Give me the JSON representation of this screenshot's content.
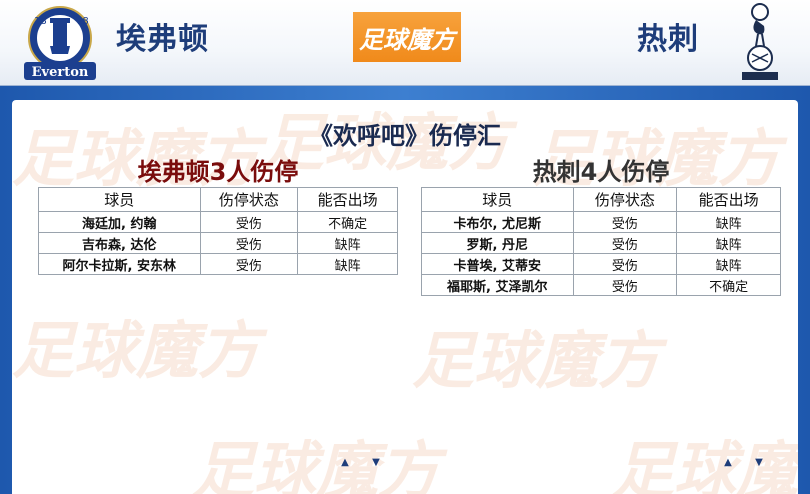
{
  "header": {
    "home_team": "埃弗顿",
    "away_team": "热刺",
    "brand": "足球魔方",
    "home_crest_text": "Everton",
    "home_crest_years": [
      "18",
      "78"
    ]
  },
  "title": "《欢呼吧》伤停汇",
  "home": {
    "section_title": "埃弗顿3人伤停",
    "columns": [
      "球员",
      "伤停状态",
      "能否出场"
    ],
    "rows": [
      [
        "海廷加, 约翰",
        "受伤",
        "不确定"
      ],
      [
        "吉布森, 达伦",
        "受伤",
        "缺阵"
      ],
      [
        "阿尔卡拉斯, 安东林",
        "受伤",
        "缺阵"
      ]
    ]
  },
  "away": {
    "section_title": "热刺4人伤停",
    "columns": [
      "球员",
      "伤停状态",
      "能否出场"
    ],
    "rows": [
      [
        "卡布尔, 尤尼斯",
        "受伤",
        "缺阵"
      ],
      [
        "罗斯, 丹尼",
        "受伤",
        "缺阵"
      ],
      [
        "卡普埃, 艾蒂安",
        "受伤",
        "缺阵"
      ],
      [
        "福耶斯, 艾泽凯尔",
        "受伤",
        "不确定"
      ]
    ]
  },
  "colors": {
    "header_text": "#1e3d7a",
    "brand_orange": "#f08a1b",
    "home_title": "#7a0c0c",
    "frame_blue": "#1e58ad"
  },
  "icons": {
    "scroll_up": "triangle-up",
    "scroll_down": "triangle-down"
  }
}
